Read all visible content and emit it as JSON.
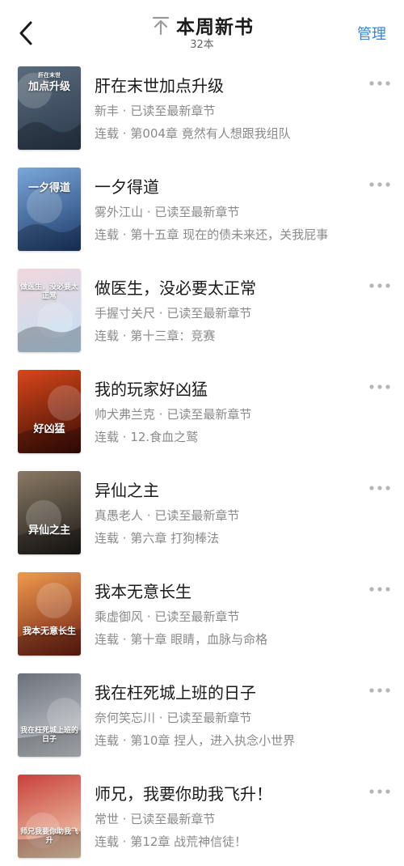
{
  "header": {
    "title": "本周新书",
    "count": "32本",
    "manage": "管理"
  },
  "books": [
    {
      "title": "肝在末世加点升级",
      "author": "新丰",
      "status": "已读至最新章节",
      "serial": "连载",
      "chapter": "第004章 竟然有人想跟我组队",
      "cover_text_top": "肝在末世",
      "cover_text_main": "加点升级",
      "cover_colors": [
        "#2b3a4d",
        "#5a6b7c"
      ]
    },
    {
      "title": "一夕得道",
      "author": "雾外江山",
      "status": "已读至最新章节",
      "serial": "连载",
      "chapter": "第十五章 现在的债未来还，关我屁事",
      "cover_text_main": "一夕得道",
      "cover_colors": [
        "#1d3b6b",
        "#7aa7d9"
      ]
    },
    {
      "title": "做医生，没必要太正常",
      "author": "手握寸关尺",
      "status": "已读至最新章节",
      "serial": "连载",
      "chapter": "第十三章：竞赛",
      "cover_text_main": "做医生，没必要太正常",
      "cover_colors": [
        "#bfe0f5",
        "#f1d6dc"
      ]
    },
    {
      "title": "我的玩家好凶猛",
      "author": "帅犬弗兰克",
      "status": "已读至最新章节",
      "serial": "连载",
      "chapter": "12.食血之鹫",
      "cover_text_main": "好凶猛",
      "cover_colors": [
        "#3a0c05",
        "#d8471a"
      ]
    },
    {
      "title": "异仙之主",
      "author": "真愚老人",
      "status": "已读至最新章节",
      "serial": "连载",
      "chapter": "第六章 打狗棒法",
      "cover_text_main": "异仙之主",
      "cover_colors": [
        "#1c1a18",
        "#8a7a64"
      ]
    },
    {
      "title": "我本无意长生",
      "author": "乘虚御风",
      "status": "已读至最新章节",
      "serial": "连载",
      "chapter": "第十章 眼睛，血脉与命格",
      "cover_text_main": "我本无意长生",
      "cover_colors": [
        "#6e1d12",
        "#f09a4e"
      ]
    },
    {
      "title": "我在枉死城上班的日子",
      "author": "奈何笑忘川",
      "status": "已读至最新章节",
      "serial": "连载",
      "chapter": "第10章 捏人，进入执念小世界",
      "cover_text_main": "我在枉死城上班的日子",
      "cover_colors": [
        "#cfd3d8",
        "#6b6f78"
      ]
    },
    {
      "title": "师兄，我要你助我飞升！",
      "author": "常世",
      "status": "已读至最新章节",
      "serial": "连载",
      "chapter": "第12章 战荒神信徒！",
      "cover_text_main": "师兄我要你助我飞升",
      "cover_colors": [
        "#f3d9b8",
        "#c9403b"
      ]
    }
  ]
}
